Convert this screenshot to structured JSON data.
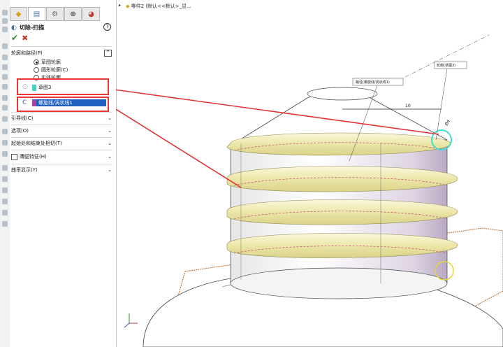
{
  "breadcrumb": {
    "text": "零件2  (默认<<默认>_显..."
  },
  "tabs": [
    "feature-manager",
    "property-manager",
    "configuration-manager",
    "dim-xpert",
    "display-manager"
  ],
  "feature": {
    "title": "切除-扫描",
    "help": "?"
  },
  "actions": {
    "ok": "✔",
    "cancel": "✖"
  },
  "profile_path": {
    "header": "轮廓和路径(P)",
    "collapse": "^",
    "options": [
      "草图轮廓",
      "圆形轮廓(C)",
      "实体轮廓"
    ],
    "selected_option": "草图轮廓",
    "profile_value": "草图3",
    "profile_color": "#3fd6c6",
    "path_value": "螺旋线/涡状线1",
    "path_color": "#b23fa0"
  },
  "sections": [
    {
      "label": "引导线(C)",
      "chevron": "⌄"
    },
    {
      "label": "选项(O)",
      "chevron": "⌄"
    },
    {
      "label": "起始处和结束处相切(T)",
      "chevron": "⌄"
    },
    {
      "label": "薄壁特征(H)",
      "chevron": "⌄",
      "checkbox": true
    },
    {
      "label": "曲率显示(Y)",
      "chevron": "⌄"
    }
  ],
  "viewport": {
    "callout_path": "路径(螺旋线/涡状线1)",
    "callout_sketch": "轮廓(草图3)",
    "dim_10": "10",
    "dim_phi": "Ø4"
  },
  "colors": {
    "highlight_red": "#e33333",
    "thread_fill": "#f0ecc0",
    "selection_cyan": "#40e0d0",
    "plane_brown": "#b96a2a"
  }
}
